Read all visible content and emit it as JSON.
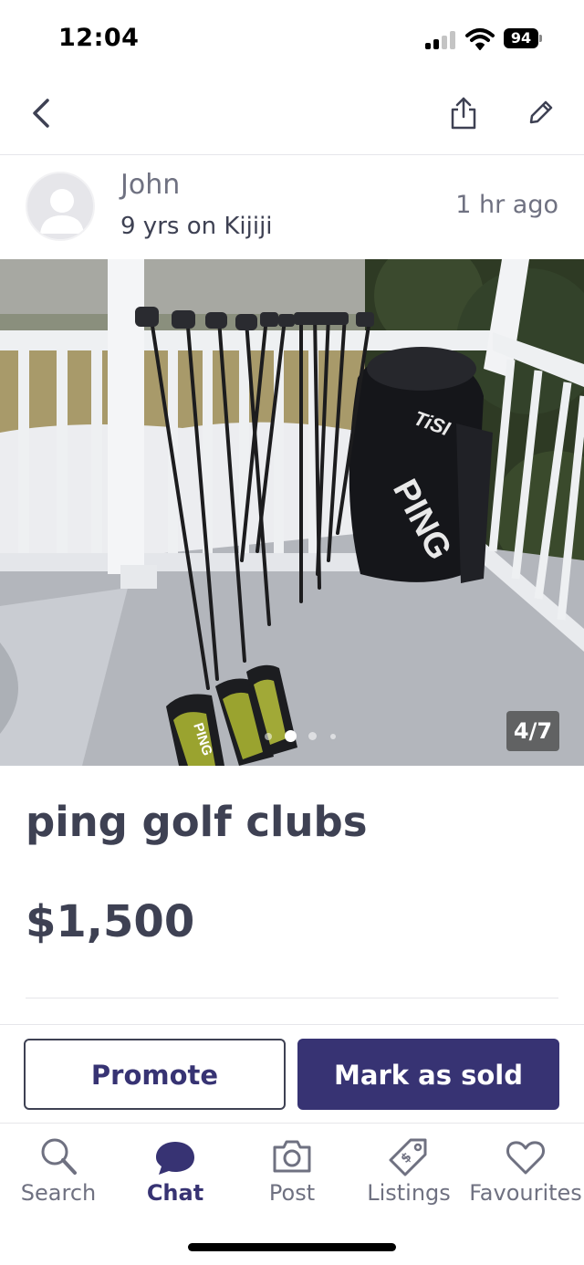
{
  "status_bar": {
    "time": "12:04",
    "battery": "94",
    "icons": [
      "cellular-signal-icon",
      "wifi-icon",
      "battery-icon"
    ]
  },
  "header": {
    "icons": [
      "back-arrow-icon",
      "share-icon",
      "edit-pencil-icon"
    ]
  },
  "seller": {
    "name": "John",
    "tenure": "9 yrs on Kijiji",
    "posted": "1 hr  ago"
  },
  "photo": {
    "counter": "4/7",
    "total": 7,
    "current": 4,
    "bag_brand": "PING",
    "bag_model": "TiSI",
    "cover_text": "PING"
  },
  "listing": {
    "title": "ping golf clubs",
    "price": "$1,500"
  },
  "actions": {
    "promote_label": "Promote",
    "sold_label": "Mark as sold"
  },
  "tabs": [
    {
      "label": "Search",
      "icon": "search-icon",
      "active": false
    },
    {
      "label": "Chat",
      "icon": "chat-bubble-icon",
      "active": true
    },
    {
      "label": "Post",
      "icon": "camera-icon",
      "active": false
    },
    {
      "label": "Listings",
      "icon": "price-tag-icon",
      "active": false
    },
    {
      "label": "Favourites",
      "icon": "heart-icon",
      "active": false
    }
  ],
  "colors": {
    "brand": "#373373",
    "text": "#3e4153",
    "muted": "#6f7181",
    "divider": "#e6e6ea"
  }
}
